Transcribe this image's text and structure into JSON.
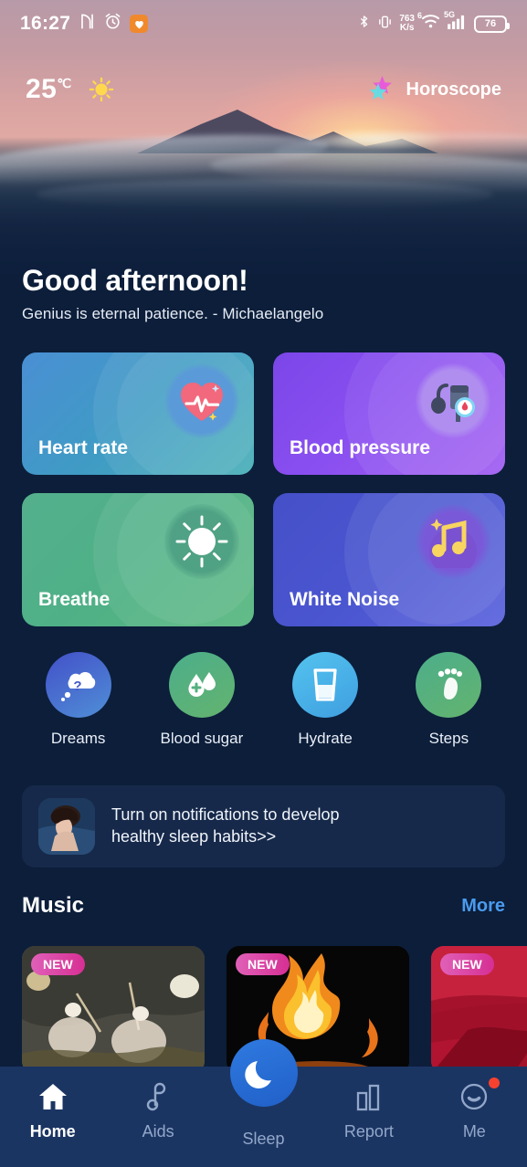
{
  "status_bar": {
    "time": "16:27",
    "icons_left": [
      "nfc-icon",
      "alarm-icon",
      "health-app-icon"
    ],
    "network_speed": "763",
    "network_speed_unit": "K/s",
    "wifi_gen": "6",
    "mobile_network": "5G",
    "battery_level": "76",
    "icons_right": [
      "bluetooth-icon",
      "vibrate-icon",
      "network-speed",
      "wifi-icon",
      "signal-icon",
      "battery-icon"
    ]
  },
  "hero": {
    "temperature": "25",
    "temperature_unit": "℃",
    "weather_icon": "sun-icon",
    "horoscope_label": "Horoscope",
    "horoscope_icon": "star-icon"
  },
  "greeting": {
    "title": "Good afternoon!",
    "quote": "Genius is eternal patience. - Michaelangelo"
  },
  "feature_cards": [
    {
      "label": "Heart rate",
      "icon": "heart-rate-icon",
      "color": "#4a8fd4"
    },
    {
      "label": "Blood pressure",
      "icon": "blood-pressure-icon",
      "color": "#8a4ff0"
    },
    {
      "label": "Breathe",
      "icon": "breathe-icon",
      "color": "#4fb087"
    },
    {
      "label": "White Noise",
      "icon": "music-note-icon",
      "color": "#4a55d0"
    }
  ],
  "quick_actions": [
    {
      "label": "Dreams",
      "icon": "thought-bubble-question-icon"
    },
    {
      "label": "Blood sugar",
      "icon": "blood-drop-icon"
    },
    {
      "label": "Hydrate",
      "icon": "water-glass-icon"
    },
    {
      "label": "Steps",
      "icon": "footprint-icon"
    }
  ],
  "notification_banner": {
    "text_line1": "Turn on notifications to develop",
    "text_line2": "healthy sleep habits>>",
    "thumbnail": "sleeping-person-thumbnail"
  },
  "music": {
    "title": "Music",
    "more_label": "More",
    "cards": [
      {
        "badge": "NEW",
        "art": "battle-painting-art"
      },
      {
        "badge": "NEW",
        "art": "campfire-art"
      },
      {
        "badge": "NEW",
        "art": "red-silk-art"
      }
    ]
  },
  "bottom_nav": {
    "items": [
      {
        "label": "Home",
        "icon": "home-icon",
        "active": true,
        "badge": false
      },
      {
        "label": "Aids",
        "icon": "music-note-icon",
        "active": false,
        "badge": false
      },
      {
        "label": "Sleep",
        "icon": "moon-icon",
        "active": false,
        "badge": false
      },
      {
        "label": "Report",
        "icon": "bar-chart-icon",
        "active": false,
        "badge": false
      },
      {
        "label": "Me",
        "icon": "smiley-face-icon",
        "active": false,
        "badge": true
      }
    ]
  },
  "colors": {
    "background": "#0d1f3c",
    "nav_background": "#1b3563",
    "accent_blue": "#4a9bee",
    "badge_pink": "#d62f93",
    "notify_dot": "#f5422f"
  }
}
